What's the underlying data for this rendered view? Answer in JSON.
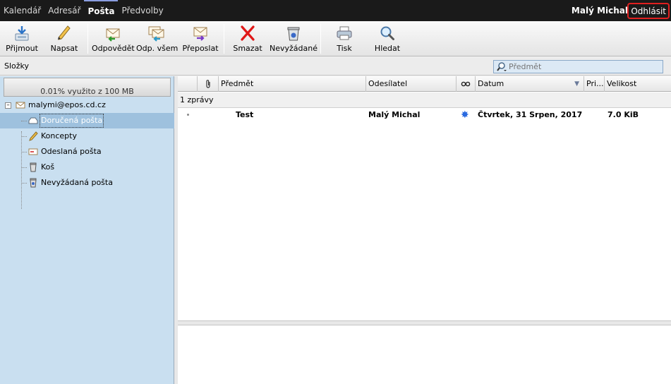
{
  "nav": {
    "items": [
      "Kalendář",
      "Adresář",
      "Pošta",
      "Předvolby"
    ],
    "active": "Pošta"
  },
  "user": {
    "name": "Malý Michal",
    "logout_label": "Odhlásit"
  },
  "toolbar": {
    "receive": "Přijmout",
    "compose": "Napsat",
    "reply": "Odpovědět",
    "reply_all": "Odp. všem",
    "forward": "Přeposlat",
    "delete": "Smazat",
    "junk": "Nevyžádané",
    "print": "Tisk",
    "search": "Hledat"
  },
  "folders_label": "Složky",
  "search": {
    "placeholder": "Předmět"
  },
  "quota": {
    "text": "0.01% využito z 100 MB"
  },
  "tree": {
    "account": "malymi@epos.cd.cz",
    "folders": [
      "Doručená pošta",
      "Koncepty",
      "Odeslaná pošta",
      "Koš",
      "Nevyžádaná pošta"
    ],
    "selected": "Doručená pošta"
  },
  "messages": {
    "columns": {
      "subject": "Předmět",
      "sender": "Odesílatel",
      "date": "Datum",
      "priority": "Pri...",
      "size": "Velikost"
    },
    "group_label": "1 zprávy",
    "rows": [
      {
        "subject": "Test",
        "sender": "Malý Michal",
        "date": "Čtvrtek, 31 Srpen, 2017 ...",
        "size": "7.0 KiB"
      }
    ]
  },
  "colors": {
    "topbar": "#1a1a1a",
    "left_panel": "#c9dff0",
    "selected_folder": "#9ec1de",
    "logout_border": "#e02020"
  }
}
